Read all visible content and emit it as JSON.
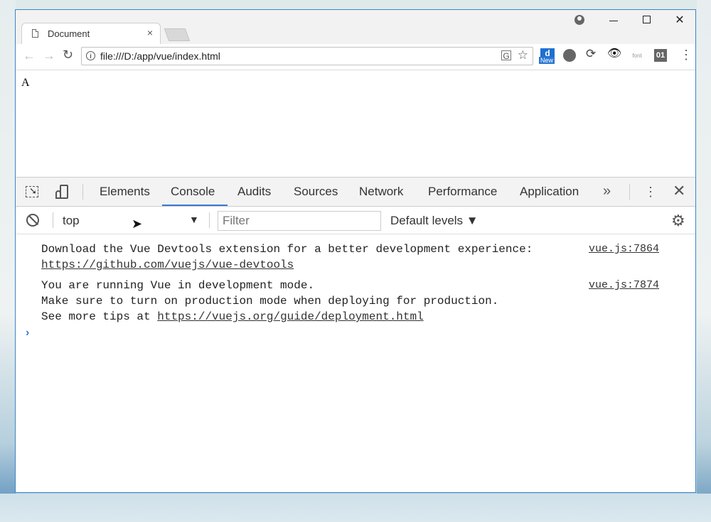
{
  "browser": {
    "tab_title": "Document",
    "tab_close": "×",
    "url": "file:///D:/app/vue/index.html",
    "window_buttons": {
      "close": "✕"
    },
    "extensions": {
      "d_label": "d",
      "d_badge": "New",
      "font_label": "font",
      "binary_label": "01",
      "eye_glyph": "👁"
    }
  },
  "page": {
    "content": "A"
  },
  "devtools": {
    "tabs": [
      "Elements",
      "Console",
      "Audits",
      "Sources",
      "Network",
      "Performance",
      "Application"
    ],
    "active_tab": "Console",
    "more_glyph": "»",
    "context": "top",
    "filter_placeholder": "Filter",
    "levels": "Default levels ▼",
    "messages": [
      {
        "line1": "Download the Vue Devtools extension for a better development experience:",
        "link": "https://github.com/vuejs/vue-devtools",
        "source": "vue.js:7864"
      },
      {
        "line1": "You are running Vue in development mode.",
        "line2": "Make sure to turn on production mode when deploying for production.",
        "line3_prefix": "See more tips at ",
        "link": "https://vuejs.org/guide/deployment.html",
        "source": "vue.js:7874"
      }
    ],
    "prompt_glyph": "›"
  }
}
